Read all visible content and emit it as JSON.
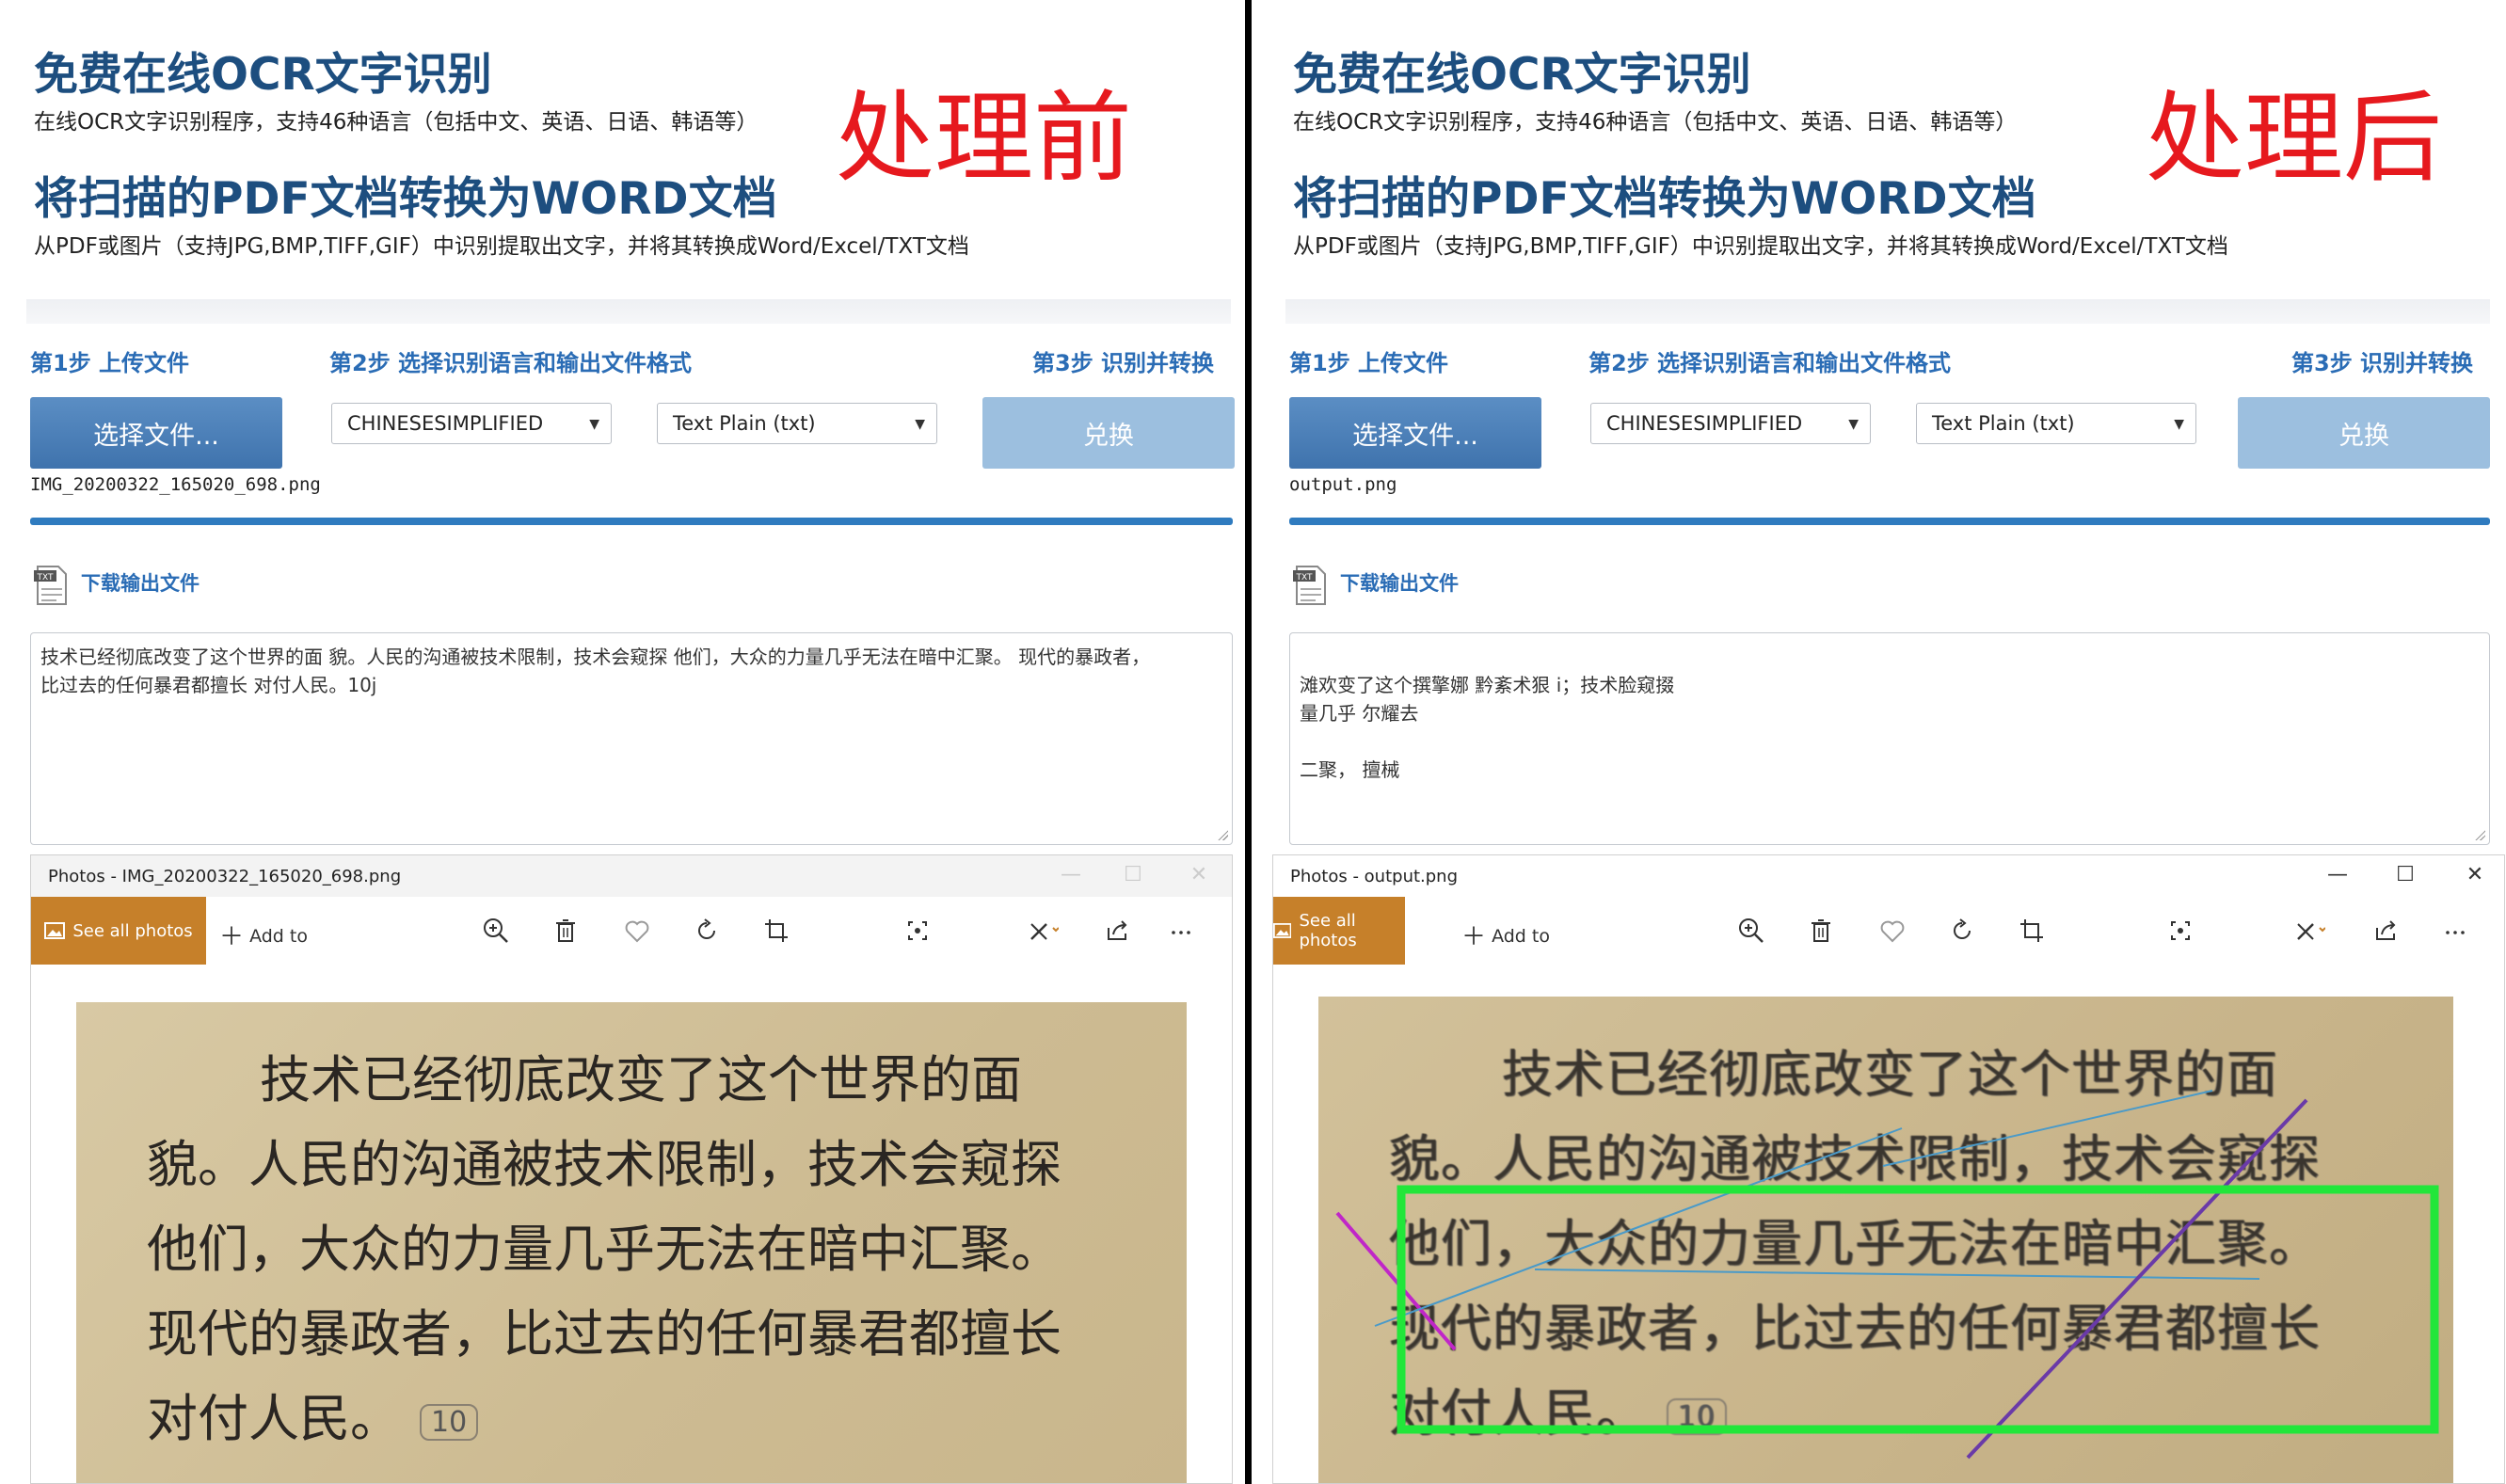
{
  "header": {
    "title1": "免费在线OCR文字识别",
    "subtitle1": "在线OCR文字识别程序，支持46种语言（包括中文、英语、日语、韩语等）",
    "title2": "将扫描的PDF文档转换为WORD文档",
    "subtitle2": "从PDF或图片（支持JPG,BMP,TIFF,GIF）中识别提取出文字，并将其转换成Word/Excel/TXT文档"
  },
  "steps": {
    "step1": "第1步 上传文件",
    "step2": "第2步 选择识别语言和输出文件格式",
    "step3": "第3步 识别并转换"
  },
  "controls": {
    "choose_file_label": "选择文件...",
    "language_selected": "CHINESESIMPLIFIED",
    "format_selected": "Text Plain (txt)",
    "convert_label": "兑换",
    "download_label": "下载输出文件"
  },
  "photos": {
    "see_all": "See all photos",
    "add_to": "Add to"
  },
  "icons": [
    "zoom-in-icon",
    "delete-icon",
    "heart-icon",
    "rotate-icon",
    "crop-icon",
    "enhance-icon",
    "edit-icon",
    "share-icon",
    "more-icon",
    "txt-file-icon",
    "photo-icon"
  ],
  "left": {
    "stage_label": "处理前",
    "filename": "IMG_20200322_165020_698.png",
    "ocr_lines": [
      "技术已经彻底改变了这个世界的面 貌。人民的沟通被技术限制，技术会窥探 他们，大众的力量几乎无法在暗中汇聚。 现代的暴政者，",
      "比过去的任何暴君都擅长 对付人民。10j"
    ],
    "window_title": "Photos - IMG_20200322_165020_698.png"
  },
  "right": {
    "stage_label": "处理后",
    "filename": "output.png",
    "ocr_lines": [
      "",
      "滩欢变了这个撰擎娜 黔紊术狠 i；技术脸窥掇",
      "量几乎 尔耀去",
      "",
      "二聚， 擅械"
    ],
    "window_title": "Photos - output.png"
  },
  "image_text": {
    "lines": [
      "技术已经彻底改变了这个世界的面",
      "貌。人民的沟通被技术限制，技术会窥探",
      "他们，大众的力量几乎无法在暗中汇聚。",
      "现代的暴政者，比过去的任何暴君都擅长",
      "对付人民。"
    ],
    "page_number": "10"
  },
  "colors": {
    "title_blue": "#1d4e7f",
    "step_blue": "#2a6cb5",
    "stage_red": "#e6191e",
    "button_blue": "#4a7fb8",
    "convert_disabled": "#9cbfdf",
    "photos_accent": "#c6802a",
    "highlight_green": "#22e63a"
  }
}
